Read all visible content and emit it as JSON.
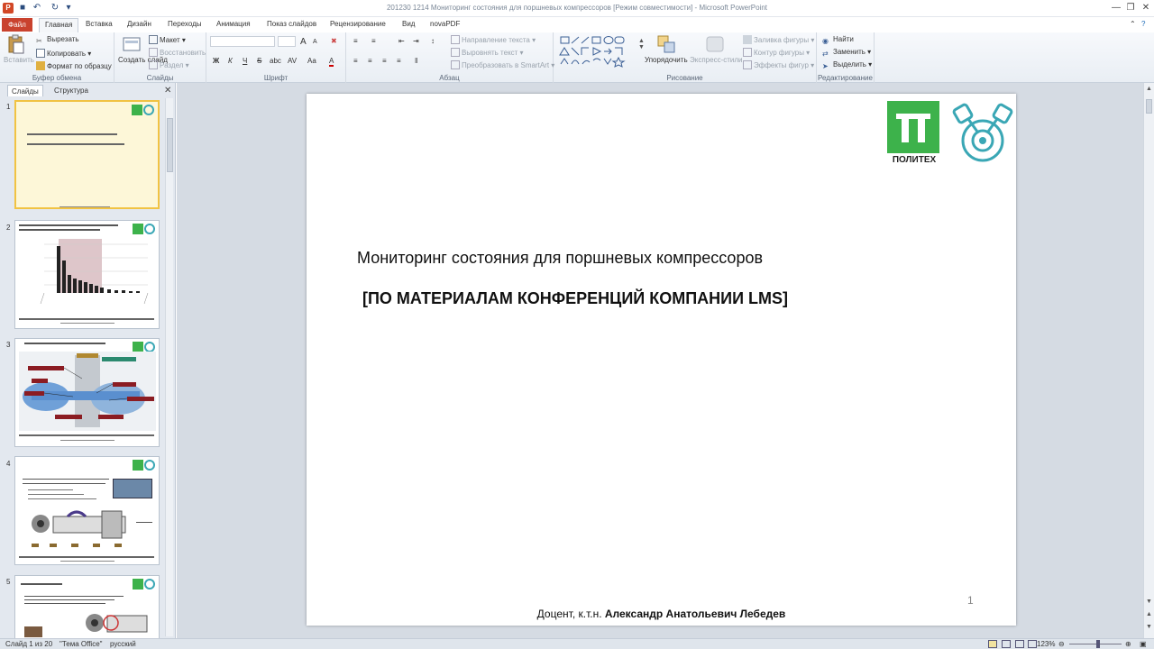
{
  "window": {
    "title": "201230 1214 Мониторинг состояния для поршневых компрессоров [Режим совместимости] - Microsoft PowerPoint",
    "app_icon": "P"
  },
  "tabs": [
    "Файл",
    "Главная",
    "Вставка",
    "Дизайн",
    "Переходы",
    "Анимация",
    "Показ слайдов",
    "Рецензирование",
    "Вид",
    "novaPDF"
  ],
  "ribbon": {
    "clipboard": {
      "label": "Буфер обмена",
      "paste": "Вставить",
      "cut": "Вырезать",
      "copy": "Копировать",
      "format_painter": "Формат по образцу"
    },
    "slides": {
      "label": "Слайды",
      "new_slide": "Создать слайд",
      "layout": "Макет",
      "reset": "Восстановить",
      "section": "Раздел"
    },
    "font": {
      "label": "Шрифт",
      "bold": "Ж",
      "italic": "К",
      "underline": "Ч",
      "strike": "S",
      "shadow": "abc",
      "spacing": "AV",
      "case": "Аа",
      "color": "A",
      "grow": "A",
      "shrink": "A"
    },
    "paragraph": {
      "label": "Абзац",
      "text_direction": "Направление текста",
      "align_text": "Выровнять текст",
      "smartart": "Преобразовать в SmartArt"
    },
    "drawing": {
      "label": "Рисование",
      "arrange": "Упорядочить",
      "quick_styles": "Экспресс-стили",
      "fill": "Заливка фигуры",
      "outline": "Контур фигуры",
      "effects": "Эффекты фигур"
    },
    "editing": {
      "label": "Редактирование",
      "find": "Найти",
      "replace": "Заменить",
      "select": "Выделить"
    }
  },
  "panel": {
    "tab_slides": "Слайды",
    "tab_outline": "Структура",
    "slide_numbers": [
      "1",
      "2",
      "3",
      "4",
      "5"
    ]
  },
  "slide": {
    "title": "Мониторинг состояния для поршневых компрессоров",
    "subtitle": "[ПО МАТЕРИАЛАМ КОНФЕРЕНЦИЙ КОМПАНИИ LMS]",
    "number": "1",
    "author_prefix": "Доцент, к.т.н.",
    "author_name": "Александр Анатольевич Лебедев",
    "logo_text": "ПОЛИТЕХ",
    "colors": {
      "logo_green": "#3db24b",
      "logo_teal": "#3aa7b5"
    }
  },
  "status": {
    "slide_pos": "Слайд 1 из 20",
    "theme": "\"Тема Office\"",
    "language": "русский",
    "zoom": "123%"
  }
}
